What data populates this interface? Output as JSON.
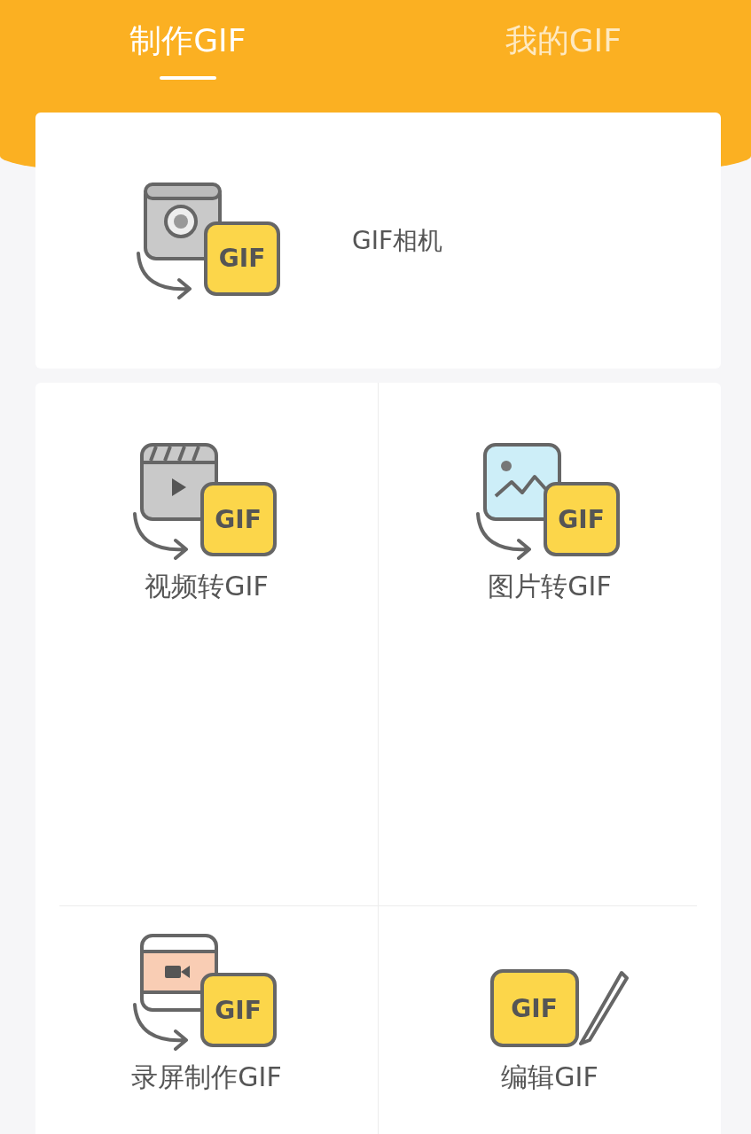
{
  "tabs": [
    {
      "label": "制作GIF",
      "selected": true
    },
    {
      "label": "我的GIF",
      "selected": false
    }
  ],
  "featured": {
    "kind": "camera",
    "badge": "GIF",
    "label": "GIF相机"
  },
  "tools": [
    {
      "kind": "video",
      "badge": "GIF",
      "label": "视频转GIF"
    },
    {
      "kind": "image",
      "badge": "GIF",
      "label": "图片转GIF"
    },
    {
      "kind": "screen",
      "badge": "GIF",
      "label": "录屏制作GIF"
    },
    {
      "kind": "edit",
      "badge": "GIF",
      "label": "编辑GIF"
    }
  ]
}
